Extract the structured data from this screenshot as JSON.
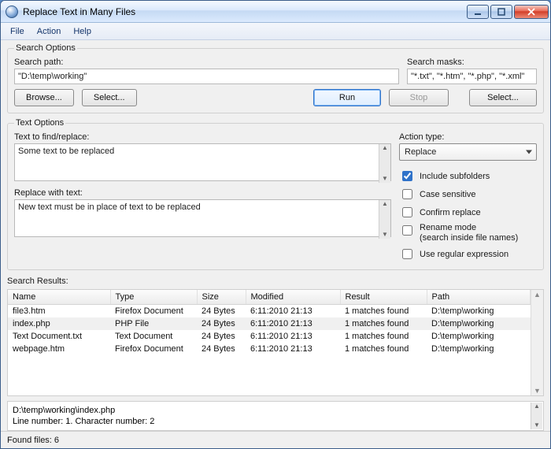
{
  "window": {
    "title": "Replace Text in Many Files"
  },
  "menu": {
    "file": "File",
    "action": "Action",
    "help": "Help"
  },
  "search_options": {
    "legend": "Search Options",
    "path_label": "Search path:",
    "path_value": "\"D:\\temp\\working\"",
    "masks_label": "Search masks:",
    "masks_value": "\"*.txt\", \"*.htm\", \"*.php\", \"*.xml\"",
    "browse": "Browse...",
    "select_left": "Select...",
    "run": "Run",
    "stop": "Stop",
    "select_right": "Select..."
  },
  "text_options": {
    "legend": "Text Options",
    "find_label": "Text to find/replace:",
    "find_value": "Some text to be replaced",
    "replace_label": "Replace with text:",
    "replace_value": "New text must be in place of text to be replaced",
    "action_type_label": "Action type:",
    "action_type_value": "Replace",
    "chk_include": "Include subfolders",
    "chk_case": "Case sensitive",
    "chk_confirm": "Confirm replace",
    "chk_rename_line1": "Rename mode",
    "chk_rename_line2": "(search inside file names)",
    "chk_regex": "Use regular expression"
  },
  "results": {
    "legend": "Search Results:",
    "cols": {
      "name": "Name",
      "type": "Type",
      "size": "Size",
      "modified": "Modified",
      "result": "Result",
      "path": "Path"
    },
    "rows": [
      {
        "name": "file3.htm",
        "type": "Firefox Document",
        "size": "24 Bytes",
        "modified": "6:11:2010  21:13",
        "result": "1 matches found",
        "path": "D:\\temp\\working"
      },
      {
        "name": "index.php",
        "type": "PHP File",
        "size": "24 Bytes",
        "modified": "6:11:2010  21:13",
        "result": "1 matches found",
        "path": "D:\\temp\\working"
      },
      {
        "name": "Text Document.txt",
        "type": "Text Document",
        "size": "24 Bytes",
        "modified": "6:11:2010  21:13",
        "result": "1 matches found",
        "path": "D:\\temp\\working"
      },
      {
        "name": "webpage.htm",
        "type": "Firefox Document",
        "size": "24 Bytes",
        "modified": "6:11:2010  21:13",
        "result": "1 matches found",
        "path": "D:\\temp\\working"
      }
    ],
    "details_line1": "D:\\temp\\working\\index.php",
    "details_line2": "Line number: 1. Character number: 2"
  },
  "status": {
    "found": "Found files: 6"
  }
}
